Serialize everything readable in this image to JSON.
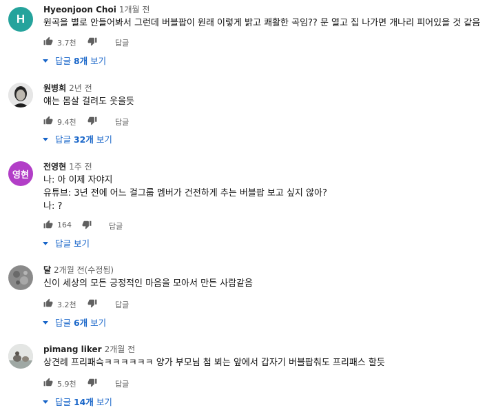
{
  "colors": {
    "reply_link": "#1966c9",
    "meta_text": "#606060",
    "avatar_h": "#25a39c",
    "avatar_yh": "#b23ec7"
  },
  "icons": {
    "like": "thumbs-up-icon",
    "dislike": "thumbs-down-icon",
    "expand": "caret-down-icon"
  },
  "comments": [
    {
      "avatar_letter": "H",
      "author": "Hyeonjoon Choi",
      "time": "1개월 전",
      "lines": [
        "원곡을 별로 안들어봐서 그런데 버블팝이 원래 이렇게 밝고 쾌활한 곡임?? 문 열고 집 나가면 개나리 피어있을 것 같음"
      ],
      "likes": "3.7천",
      "reply_label": "답글",
      "replies_prefix": "답글 ",
      "replies_count": "8개",
      "replies_suffix": " 보기"
    },
    {
      "author": "원병희",
      "time": "2년 전",
      "lines": [
        "얘는 몸살 걸려도 웃을듯"
      ],
      "likes": "9.4천",
      "reply_label": "답글",
      "replies_prefix": "답글 ",
      "replies_count": "32개",
      "replies_suffix": " 보기"
    },
    {
      "avatar_letter": "영현",
      "author": "전영현",
      "time": "1주 전",
      "lines": [
        "나: 아 이제 자야지",
        "유튜브: 3년 전에 어느 걸그룹 멤버가 건전하게 추는 버블팝 보고 싶지 않아?",
        "나: ?"
      ],
      "likes": "164",
      "reply_label": "답글",
      "replies_prefix": "답글 ",
      "replies_count": "",
      "replies_suffix": "보기"
    },
    {
      "author": "달",
      "time": "2개월 전(수정됨)",
      "lines": [
        "신이 세상의 모든 긍정적인 마음을 모아서 만든 사람같음"
      ],
      "likes": "3.2천",
      "reply_label": "답글",
      "replies_prefix": "답글 ",
      "replies_count": "6개",
      "replies_suffix": " 보기"
    },
    {
      "author": "pimang liker",
      "time": "2개월 전",
      "lines": [
        "상견례 프리패슥ㅋㅋㅋㅋㅋㅋ 양가 부모님 첨 뵈는 앞에서 갑자기 버블팝춰도 프리패스 할듯"
      ],
      "likes": "5.9천",
      "reply_label": "답글",
      "replies_prefix": "답글 ",
      "replies_count": "14개",
      "replies_suffix": " 보기"
    }
  ]
}
